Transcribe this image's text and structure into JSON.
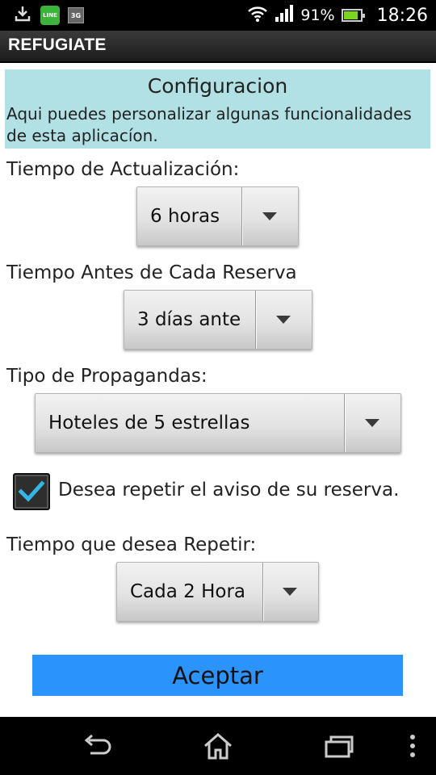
{
  "status_bar": {
    "battery": "91%",
    "time": "18:26",
    "icons": [
      "download-icon",
      "line-app-icon",
      "3g-icon",
      "wifi-icon",
      "signal-icon",
      "battery-icon"
    ],
    "line_text": "LINE",
    "g3_text": "3G"
  },
  "app": {
    "title": "REFUGIATE"
  },
  "info": {
    "title": "Configuracion",
    "text": "Aqui puedes personalizar algunas funcionalidades de esta aplicacíon."
  },
  "settings": {
    "update_label": "Tiempo de Actualización:",
    "update_value": "6 horas",
    "before_label": "Tiempo Antes de Cada Reserva",
    "before_value": "3 días ante",
    "ads_label": "Tipo de Propagandas:",
    "ads_value": "Hoteles de 5 estrellas",
    "repeat_checkbox_label": "Desea repetir el aviso de su reserva.",
    "repeat_checked": true,
    "repeat_label": "Tiempo que desea Repetir:",
    "repeat_value": "Cada 2 Hora"
  },
  "actions": {
    "accept": "Aceptar"
  },
  "colors": {
    "info_bg": "#b1e1e5",
    "accept_bg": "#2b93fc",
    "check_color": "#33b5e5",
    "battery_fill": "#7dd321"
  }
}
